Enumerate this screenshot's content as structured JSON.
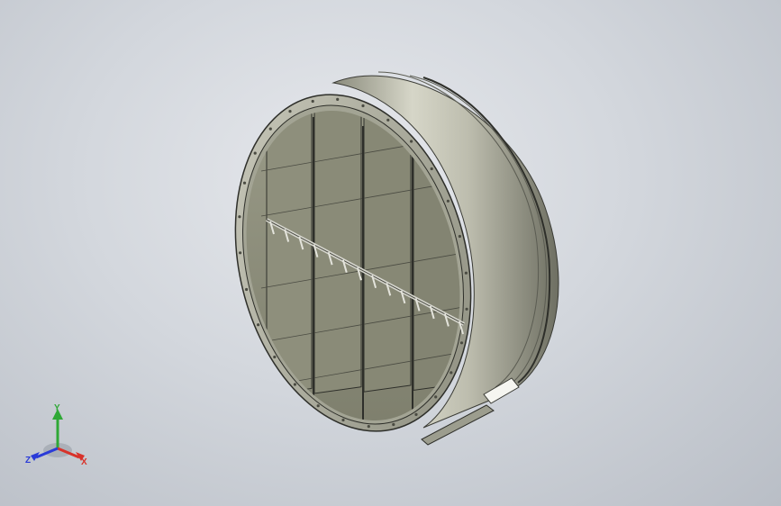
{
  "viewport": {
    "background_top": "#e6e8ec",
    "background_bottom": "#b9bec6"
  },
  "model": {
    "description_icon": "damper-assembly-3d-model",
    "metal_color": "#b9b9a9",
    "panel_color": "#8e8f7c",
    "edge_color": "#2e2f2a",
    "panel_columns": 4,
    "panel_rows": 3
  },
  "triad": {
    "x_label": "X",
    "y_label": "Y",
    "z_label": "Z",
    "x_color": "#d8322a",
    "y_color": "#2fa836",
    "z_color": "#2a3bd8"
  }
}
